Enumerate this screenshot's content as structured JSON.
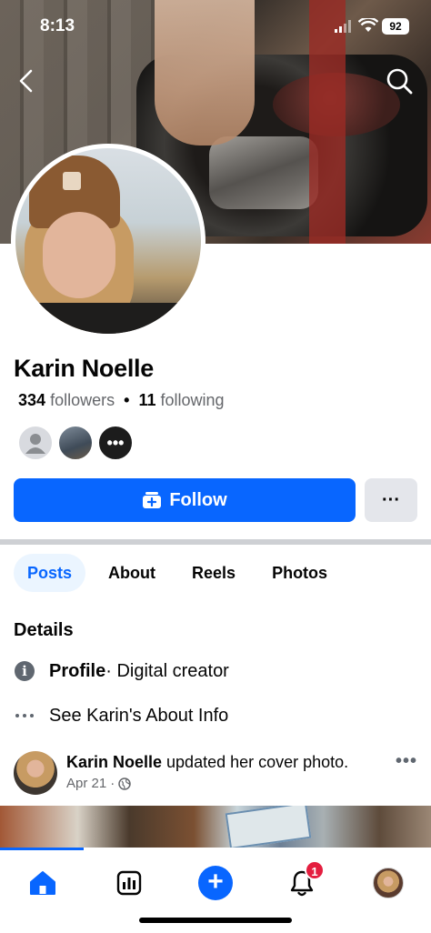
{
  "status_bar": {
    "time": "8:13",
    "battery": "92"
  },
  "profile": {
    "name": "Karin Noelle",
    "followers_count": "334",
    "followers_label": "followers",
    "separator": "•",
    "following_count": "11",
    "following_label": "following",
    "mutuals_more": "•••"
  },
  "actions": {
    "follow_label": "Follow",
    "more_label": "···"
  },
  "tabs": [
    {
      "label": "Posts",
      "active": true
    },
    {
      "label": "About",
      "active": false
    },
    {
      "label": "Reels",
      "active": false
    },
    {
      "label": "Photos",
      "active": false
    }
  ],
  "details": {
    "heading": "Details",
    "profile_bold": "Profile",
    "profile_rest": " · Digital creator",
    "about_link": "See Karin's About Info"
  },
  "post": {
    "author": "Karin Noelle",
    "action": " updated her cover photo.",
    "date": "Apr 21",
    "dot": "·",
    "more": "•••"
  },
  "nav": {
    "notification_count": "1",
    "icons": [
      "home-icon",
      "dashboard-icon",
      "create-icon",
      "bell-icon",
      "profile-avatar"
    ]
  },
  "colors": {
    "accent": "#0866ff",
    "badge": "#e41e3f",
    "tab_active_bg": "#ebf5ff"
  }
}
